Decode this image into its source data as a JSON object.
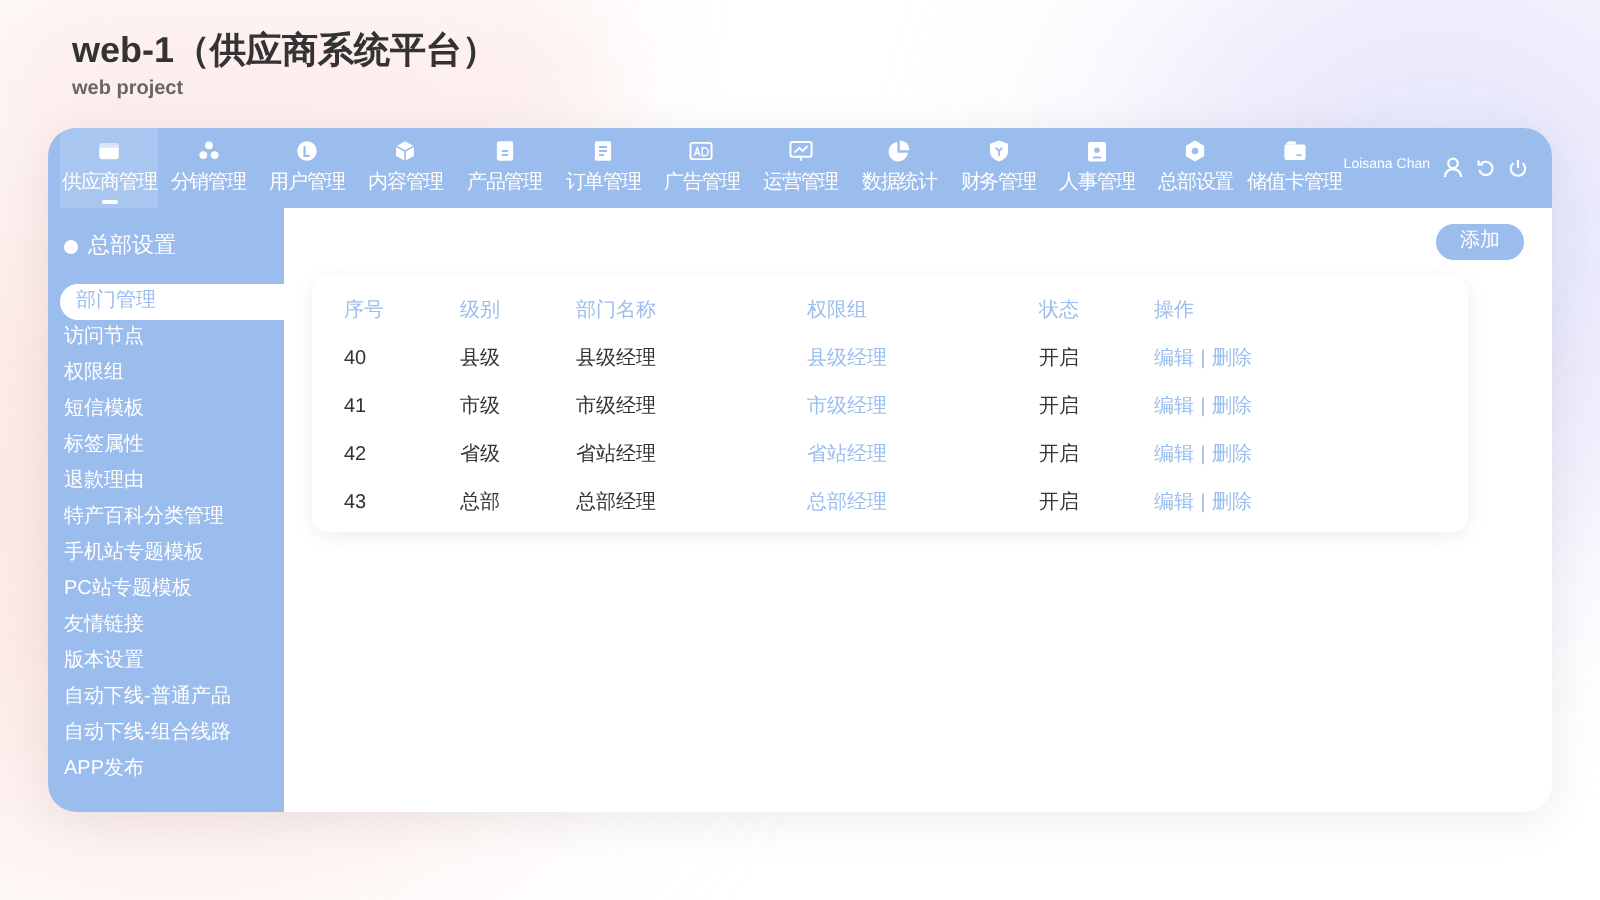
{
  "title": "web-1（供应商系统平台）",
  "subtitle": "web project",
  "nav": [
    {
      "label": "供应商管理",
      "selected": true
    },
    {
      "label": "分销管理",
      "selected": false
    },
    {
      "label": "用户管理",
      "selected": false
    },
    {
      "label": "内容管理",
      "selected": false
    },
    {
      "label": "产品管理",
      "selected": false
    },
    {
      "label": "订单管理",
      "selected": false
    },
    {
      "label": "广告管理",
      "selected": false
    },
    {
      "label": "运营管理",
      "selected": false
    },
    {
      "label": "数据统计",
      "selected": false
    },
    {
      "label": "财务管理",
      "selected": false
    },
    {
      "label": "人事管理",
      "selected": false
    },
    {
      "label": "总部设置",
      "selected": false
    },
    {
      "label": "储值卡管理",
      "selected": false
    }
  ],
  "user": {
    "name": "Loisana Chan"
  },
  "sidebar": {
    "heading": "总部设置",
    "items": [
      {
        "label": "部门管理",
        "selected": true
      },
      {
        "label": "访问节点",
        "selected": false
      },
      {
        "label": "权限组",
        "selected": false
      },
      {
        "label": "短信模板",
        "selected": false
      },
      {
        "label": "标签属性",
        "selected": false
      },
      {
        "label": "退款理由",
        "selected": false
      },
      {
        "label": "特产百科分类管理",
        "selected": false
      },
      {
        "label": "手机站专题模板",
        "selected": false
      },
      {
        "label": "PC站专题模板",
        "selected": false
      },
      {
        "label": "友情链接",
        "selected": false
      },
      {
        "label": "版本设置",
        "selected": false
      },
      {
        "label": "自动下线-普通产品",
        "selected": false
      },
      {
        "label": "自动下线-组合线路",
        "selected": false
      },
      {
        "label": "APP发布",
        "selected": false
      }
    ]
  },
  "add_button": "添加",
  "table": {
    "columns": [
      "序号",
      "级别",
      "部门名称",
      "权限组",
      "状态",
      "操作"
    ],
    "rows": [
      {
        "id": "40",
        "level": "县级",
        "name": "县级经理",
        "group": "县级经理",
        "status": "开启",
        "actions": [
          "编辑",
          "|",
          "删除"
        ]
      },
      {
        "id": "41",
        "level": "市级",
        "name": "市级经理",
        "group": "市级经理",
        "status": "开启",
        "actions": [
          "编辑",
          "|",
          "删除"
        ]
      },
      {
        "id": "42",
        "level": "省级",
        "name": "省站经理",
        "group": "省站经理",
        "status": "开启",
        "actions": [
          "编辑",
          "|",
          "删除"
        ]
      },
      {
        "id": "43",
        "level": "总部",
        "name": "总部经理",
        "group": "总部经理",
        "status": "开启",
        "actions": [
          "编辑",
          "|",
          "删除"
        ]
      }
    ]
  }
}
